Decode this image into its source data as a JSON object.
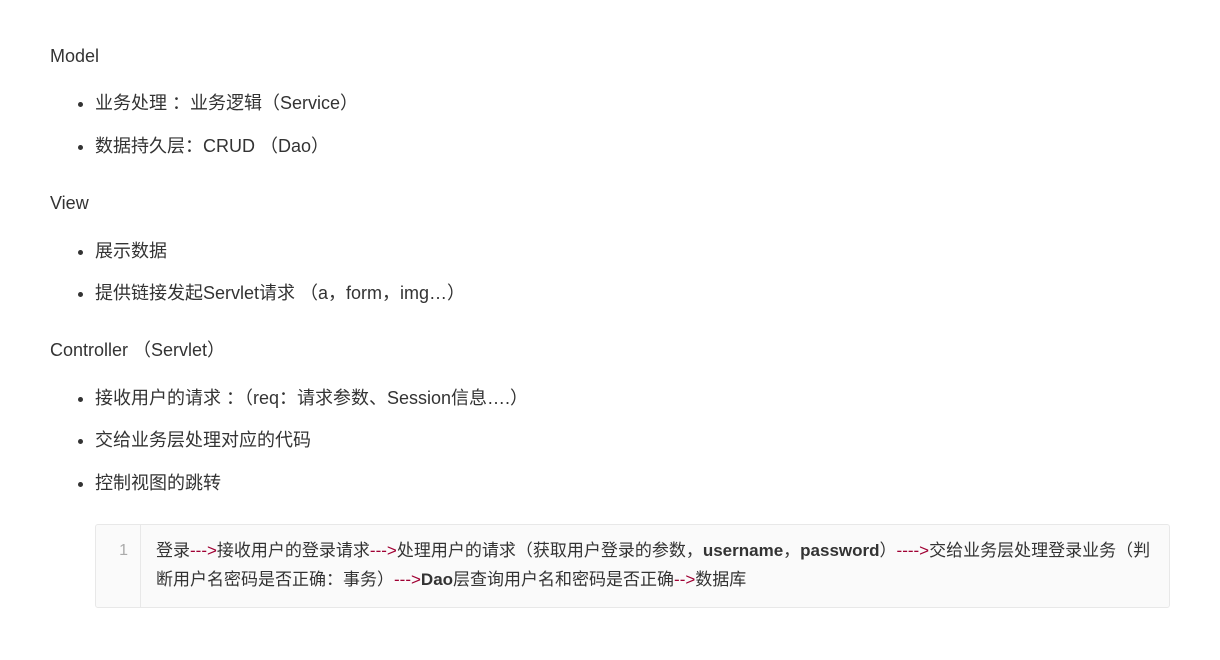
{
  "sections": {
    "model": {
      "heading": "Model",
      "items": [
        "业务处理 ：业务逻辑（Service）",
        "数据持久层：CRUD  （Dao）"
      ]
    },
    "view": {
      "heading": "View",
      "items": [
        "展示数据",
        "提供链接发起Servlet请求 （a，form，img…）"
      ]
    },
    "controller": {
      "heading": "Controller  （Servlet）",
      "items": [
        "接收用户的请求 ：（req：请求参数、Session信息….）",
        "交给业务层处理对应的代码",
        "控制视图的跳转"
      ]
    }
  },
  "code": {
    "lineNumber": "1",
    "segments": [
      {
        "type": "text",
        "content": "登录"
      },
      {
        "type": "arrow",
        "content": "--->"
      },
      {
        "type": "text",
        "content": "接收用户的登录请求"
      },
      {
        "type": "arrow",
        "content": "--->"
      },
      {
        "type": "text",
        "content": "处理用户的请求（获取用户登录的参数，"
      },
      {
        "type": "keyword",
        "content": "username"
      },
      {
        "type": "text",
        "content": "，"
      },
      {
        "type": "keyword",
        "content": "password"
      },
      {
        "type": "text",
        "content": "）"
      },
      {
        "type": "arrow",
        "content": "---->"
      },
      {
        "type": "text",
        "content": "交给业务层处理登录业务（判断用户名密码是否正确：事务）"
      },
      {
        "type": "arrow",
        "content": "--->"
      },
      {
        "type": "keyword",
        "content": "Dao"
      },
      {
        "type": "text",
        "content": "层查询用户名和密码是否正确"
      },
      {
        "type": "arrow",
        "content": "-->"
      },
      {
        "type": "text",
        "content": "数据库"
      }
    ]
  }
}
